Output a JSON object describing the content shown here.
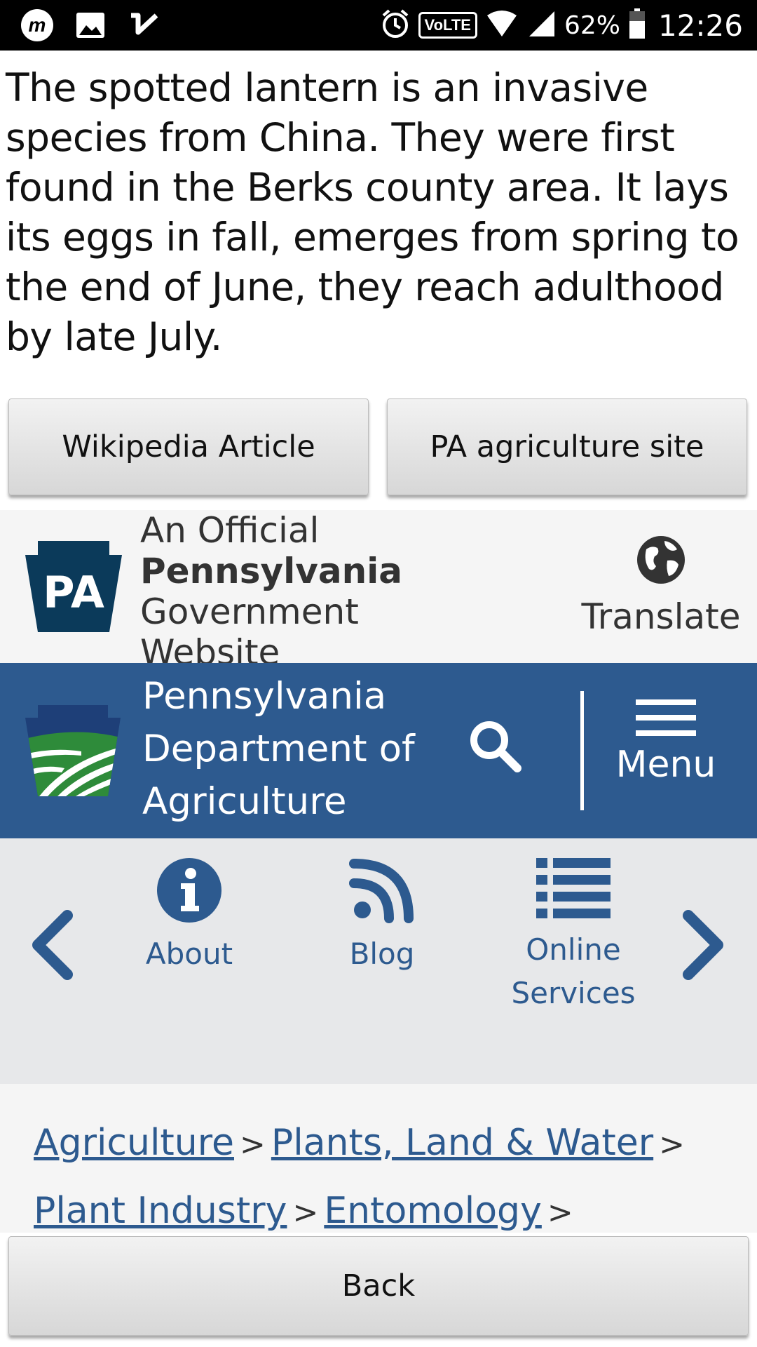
{
  "status_bar": {
    "icons_left": [
      "m-app-icon",
      "image-icon",
      "check-icon"
    ],
    "icons_right": [
      "alarm-icon",
      "volte-badge",
      "wifi-icon",
      "signal-icon",
      "battery-icon"
    ],
    "volte_label": "VoLTE",
    "battery_pct": "62%",
    "time": "12:26"
  },
  "description": "The spotted lantern is an invasive species from China. They were first found in the Berks county area. It lays its eggs in fall, emerges from spring to the end of June, they reach adulthood by late July.",
  "buttons": {
    "wikipedia": "Wikipedia Article",
    "pa_agriculture": "PA agriculture site",
    "back": "Back"
  },
  "webview": {
    "official_bar": {
      "keystone_text": "PA",
      "line1": "An Official",
      "line2": "Pennsylvania",
      "line3": "Government",
      "line4": "Website",
      "translate_label": "Translate"
    },
    "department": {
      "line1": "Pennsylvania",
      "line2": "Department of",
      "line3": "Agriculture",
      "menu_label": "Menu"
    },
    "quicknav": {
      "items": [
        {
          "label": "About",
          "icon": "info-icon"
        },
        {
          "label": "Blog",
          "icon": "rss-icon"
        },
        {
          "label_line1": "Online",
          "label_line2": "Services",
          "icon": "list-icon"
        }
      ]
    },
    "breadcrumb": {
      "items": [
        "Agriculture",
        "Plants, Land & Water",
        "Plant Industry",
        "Entomology"
      ],
      "separator": ">"
    },
    "colors": {
      "brand_blue": "#2d5a8f",
      "dark_navy": "#0b3a5a"
    }
  }
}
